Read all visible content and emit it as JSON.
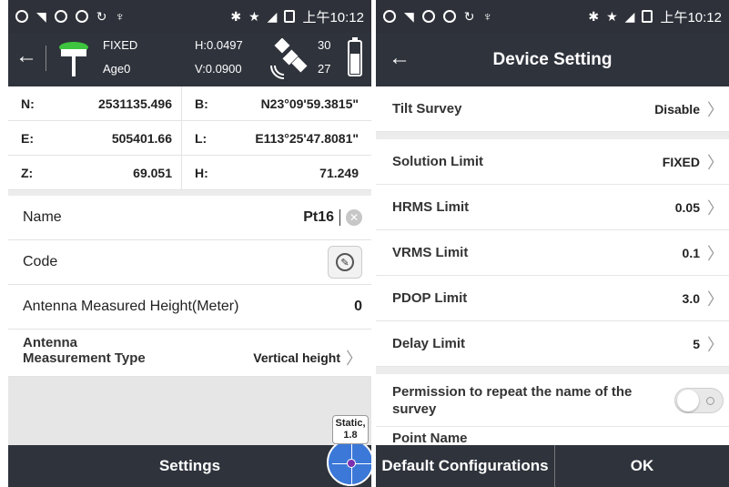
{
  "status_bar": {
    "time": "上午10:12"
  },
  "gnss": {
    "fix_status": "FIXED",
    "age": "Age0",
    "h_precision": "H:0.0497",
    "v_precision": "V:0.0900",
    "sat_used": "30",
    "sat_tracked": "27"
  },
  "coords": {
    "n_label": "N:",
    "n_value": "2531135.496",
    "b_label": "B:",
    "b_value": "N23°09'59.3815\"",
    "e_label": "E:",
    "e_value": "505401.66",
    "l_label": "L:",
    "l_value": "E113°25'47.8081\"",
    "z_label": "Z:",
    "z_value": "69.051",
    "h_label": "H:",
    "h_value": "71.249"
  },
  "form": {
    "name_label": "Name",
    "name_value": "Pt16",
    "code_label": "Code",
    "antenna_height_label": "Antenna Measured Height(Meter)",
    "antenna_height_value": "0",
    "antenna_type_label": "Antenna Measurement Type",
    "antenna_type_value": "Vertical height"
  },
  "static_badge": {
    "line1": "Static,",
    "line2": "1.8"
  },
  "left_bottom": {
    "settings_label": "Settings"
  },
  "device_setting": {
    "title": "Device Setting",
    "rows": {
      "tilt_survey": {
        "label": "Tilt Survey",
        "value": "Disable"
      },
      "solution_limit": {
        "label": "Solution Limit",
        "value": "FIXED"
      },
      "hrms_limit": {
        "label": "HRMS Limit",
        "value": "0.05"
      },
      "vrms_limit": {
        "label": "VRMS Limit",
        "value": "0.1"
      },
      "pdop_limit": {
        "label": "PDOP Limit",
        "value": "3.0"
      },
      "delay_limit": {
        "label": "Delay Limit",
        "value": "5"
      },
      "repeat_name": {
        "label": "Permission to repeat the name of the survey",
        "toggle_on": false
      },
      "point_name": {
        "label": "Point Name"
      }
    },
    "default_button": "Default Configurations",
    "ok_button": "OK"
  }
}
